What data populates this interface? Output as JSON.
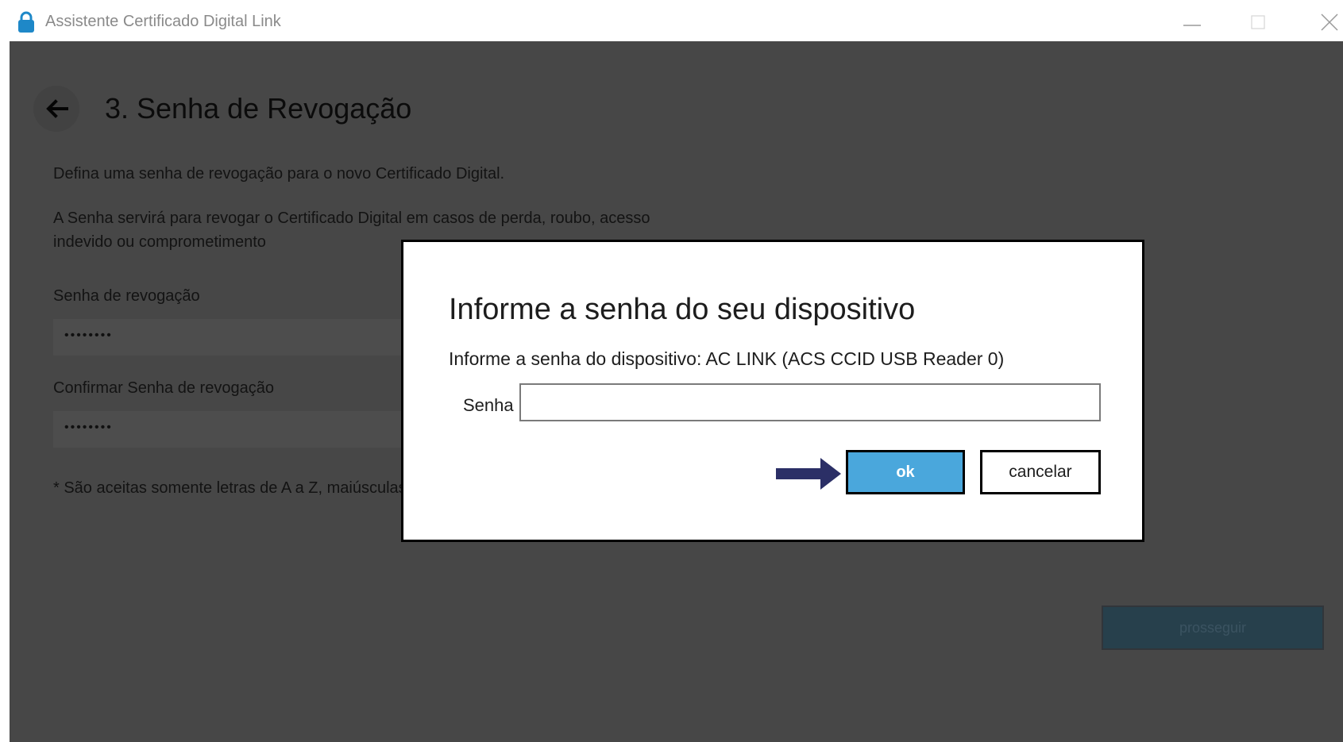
{
  "window": {
    "title": "Assistente Certificado Digital Link",
    "icon": "lock-icon",
    "accent_color": "#1e88c8"
  },
  "page": {
    "title": "3. Senha de Revogação",
    "description1": "Defina uma senha de revogação para o novo Certificado Digital.",
    "description2": "A Senha servirá para revogar o Certificado Digital em casos de perda, roubo, acesso indevido ou comprometimento",
    "field1_label": "Senha de revogação",
    "field1_value": "••••••••",
    "field2_label": "Confirmar Senha de revogação",
    "field2_value": "••••••••",
    "footnote": "* São aceitas somente letras de A a Z, maiúsculas",
    "continue_label": "prosseguir"
  },
  "dialog": {
    "title": "Informe a senha do seu dispositivo",
    "message": "Informe a senha do dispositivo: AC LINK (ACS CCID USB Reader 0)",
    "password_label": "Senha",
    "password_value": "",
    "ok_label": "ok",
    "cancel_label": "cancelar",
    "ok_color": "#4aa7dc",
    "indicator_color": "#2b2f66"
  }
}
